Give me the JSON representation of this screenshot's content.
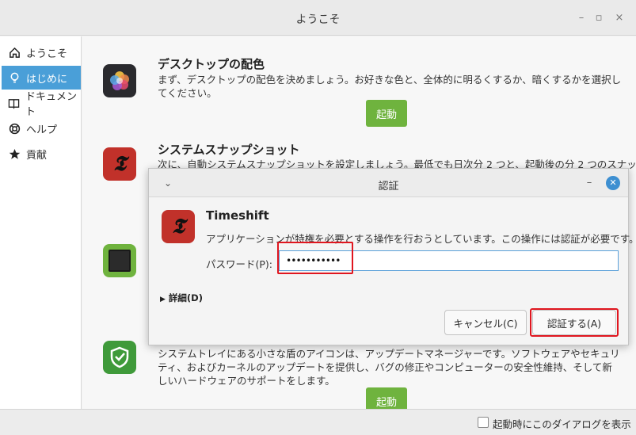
{
  "window": {
    "title": "ようこそ",
    "controls": {
      "minimize": "–",
      "maximize": "▫",
      "close": "×"
    }
  },
  "sidebar": {
    "items": [
      {
        "label": "ようこそ",
        "icon": "home-icon"
      },
      {
        "label": "はじめに",
        "icon": "lightbulb-icon",
        "active": true
      },
      {
        "label": "ドキュメント",
        "icon": "book-icon"
      },
      {
        "label": "ヘルプ",
        "icon": "lifebuoy-icon"
      },
      {
        "label": "貢献",
        "icon": "star-icon"
      }
    ]
  },
  "main": {
    "sections": [
      {
        "title": "デスクトップの配色",
        "description": "まず、デスクトップの配色を決めましょう。お好きな色と、全体的に明るくするか、暗くするかを選択してください。",
        "button": "起動",
        "icon": "color-palette-icon"
      },
      {
        "title": "システムスナップショット",
        "description": "次に、自動システムスナップショットを設定しましょう。最低でも日次分 2 つと、起動後の分 2 つのスナップ",
        "icon": "timeshift-icon"
      },
      {
        "icon": "driver-manager-icon"
      },
      {
        "description": "システムトレイにある小さな盾のアイコンは、アップデートマネージャーです。ソフトウェアやセキュリティ、およびカーネルのアップデートを提供し、バグの修正やコンピューターの安全性維持、そして新しいハードウェアのサポートをします。",
        "button": "起動",
        "icon": "shield-icon"
      }
    ]
  },
  "footer": {
    "startup_label": "起動時にこのダイアログを表示",
    "startup_checked": false
  },
  "dialog": {
    "title": "認証",
    "app_name": "Timeshift",
    "message": "アプリケーションが特権を必要とする操作を行おうとしています。この操作には認証が必要です。",
    "password_label": "パスワード(P):",
    "password_value": "•••••••••••",
    "details_label": "詳細(D)",
    "cancel_label": "キャンセル(C)",
    "auth_label": "認証する(A)"
  },
  "colors": {
    "accent": "#4a9fd8",
    "launch_button": "#6fb33e",
    "highlight": "#e0161f"
  }
}
